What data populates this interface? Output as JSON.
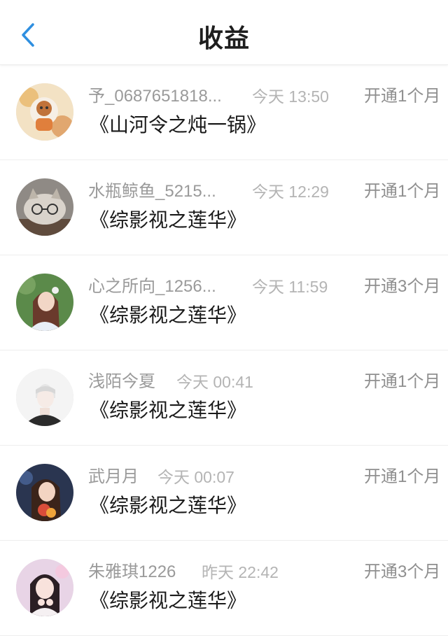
{
  "header": {
    "title": "收益",
    "back_icon": "chevron-left-icon",
    "accent_color": "#2f8fe0"
  },
  "items": [
    {
      "name": "予_0687651818...",
      "time": "今天 13:50",
      "plan": "开通1个月",
      "book": "《山河令之炖一锅》",
      "avatar_icon": "avatar-image"
    },
    {
      "name": "水瓶鲸鱼_5215...",
      "time": "今天 12:29",
      "plan": "开通1个月",
      "book": "《综影视之莲华》",
      "avatar_icon": "avatar-image"
    },
    {
      "name": "心之所向_1256...",
      "time": "今天 11:59",
      "plan": "开通3个月",
      "book": "《综影视之莲华》",
      "avatar_icon": "avatar-image"
    },
    {
      "name": "浅陌今夏",
      "time": "今天 00:41",
      "plan": "开通1个月",
      "book": "《综影视之莲华》",
      "avatar_icon": "avatar-image"
    },
    {
      "name": "武月月",
      "time": "今天 00:07",
      "plan": "开通1个月",
      "book": "《综影视之莲华》",
      "avatar_icon": "avatar-image"
    },
    {
      "name": "朱雅琪1226",
      "time": "昨天 22:42",
      "plan": "开通3个月",
      "book": "《综影视之莲华》",
      "avatar_icon": "avatar-image"
    }
  ]
}
